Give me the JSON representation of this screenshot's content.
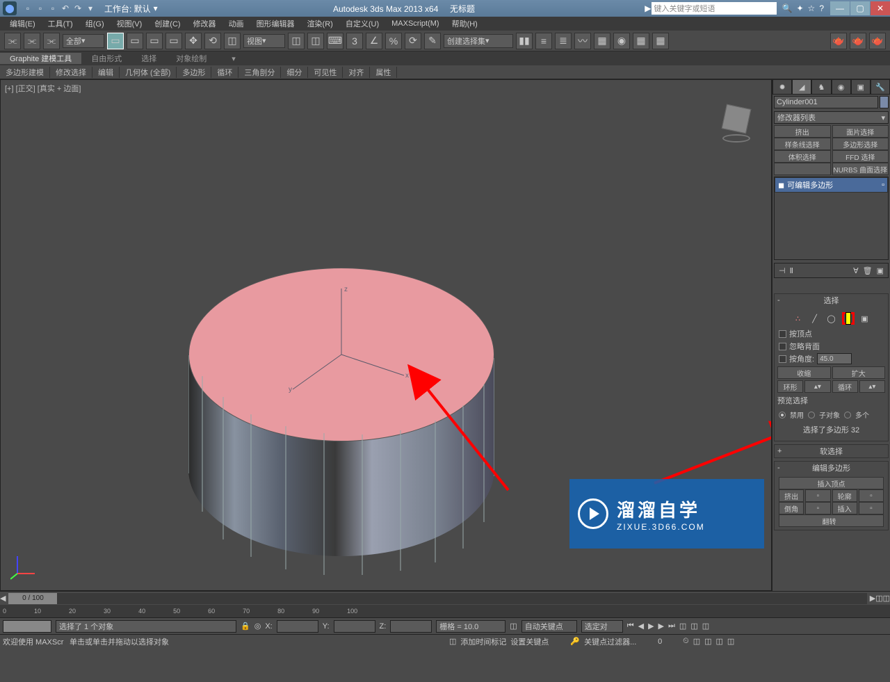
{
  "titlebar": {
    "workspace_label": "工作台: 默认",
    "app_title": "Autodesk 3ds Max  2013 x64",
    "doc_title": "无标题",
    "keyword_placeholder": "键入关键字或短语"
  },
  "menus": [
    "编辑(E)",
    "工具(T)",
    "组(G)",
    "视图(V)",
    "创建(C)",
    "修改器",
    "动画",
    "图形编辑器",
    "渲染(R)",
    "自定义(U)",
    "MAXScript(M)",
    "帮助(H)"
  ],
  "toolbar": {
    "filter_all": "全部",
    "view_dd": "视图",
    "create_set": "创建选择集"
  },
  "ribbon": {
    "tabs": [
      "Graphite 建模工具",
      "自由形式",
      "选择",
      "对象绘制"
    ],
    "groups": [
      "多边形建模",
      "修改选择",
      "编辑",
      "几何体 (全部)",
      "多边形",
      "循环",
      "三角剖分",
      "细分",
      "可见性",
      "对齐",
      "属性"
    ]
  },
  "viewport": {
    "label": "[+] [正交] [真实 + 边面]"
  },
  "cmd": {
    "obj_name": "Cylinder001",
    "mod_list": "修改器列表",
    "btns1": [
      "挤出",
      "面片选择"
    ],
    "btns2": [
      "样条线选择",
      "多边形选择"
    ],
    "btns3": [
      "体积选择",
      "FFD 选择"
    ],
    "btns4": [
      "",
      "NURBS 曲面选择"
    ],
    "stack_item": "可编辑多边形",
    "sel_rollout": "选择",
    "chk_vertex": "按顶点",
    "chk_backface": "忽略背面",
    "chk_angle": "按角度:",
    "angle_val": "45.0",
    "shrink": "收缩",
    "grow": "扩大",
    "ring": "环形",
    "loop": "循环",
    "preview_label": "预览选择",
    "disable": "禁用",
    "subobj": "子对象",
    "multi": "多个",
    "sel_info": "选择了多边形 32",
    "soft_sel": "软选择",
    "edit_poly": "编辑多边形",
    "insert_vertex": "插入顶点",
    "extrude": "挤出",
    "outline": "轮廓",
    "bevel": "倒角",
    "inset": "插入",
    "flip": "翻转"
  },
  "timeline": {
    "pos": "0 / 100"
  },
  "status": {
    "sel": "选择了 1 个对象",
    "x": "X:",
    "y": "Y:",
    "z": "Z:",
    "grid": "栅格 = 10.0",
    "hint": "单击或单击并拖动以选择对象",
    "add_time": "添加时间标记",
    "autokey": "自动关键点",
    "setkey": "设置关键点",
    "selected_label": "选定对",
    "keyfilter": "关键点过滤器...",
    "welcome": "欢迎使用  MAXScr"
  },
  "watermark": {
    "big": "溜溜自学",
    "small": "ZIXUE.3D66.COM"
  }
}
